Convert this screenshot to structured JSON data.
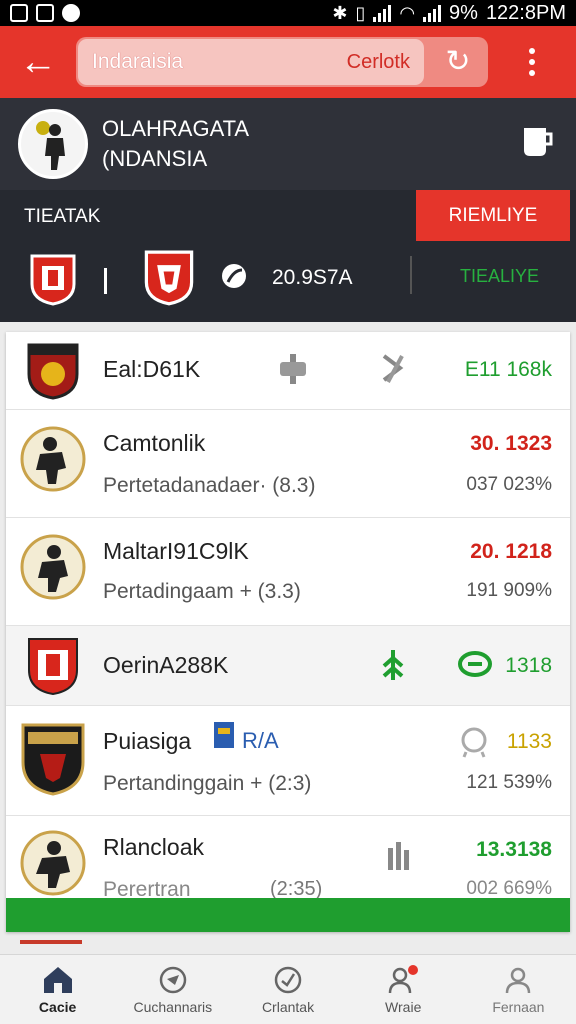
{
  "status_bar": {
    "battery": "9%",
    "time": "122:8PM"
  },
  "app_bar": {
    "search_value": "Indaraisia",
    "search_hint": "Cerlotk"
  },
  "profile": {
    "title_line1": "OLAHRAGATA",
    "title_line2": "(NDANSIA"
  },
  "match_strip": {
    "label": "TIEATAK",
    "live_button": "RIEMLIYE",
    "score": "20.9S7A",
    "live_text": "TIEALIYE"
  },
  "colors": {
    "accent": "#e5352b",
    "dark": "#2f3139",
    "green": "#1f9e2f",
    "gold": "#c9a200",
    "red": "#d1231b"
  },
  "list": [
    {
      "name": "Eal:D61K",
      "value_top": "E11  168k"
    },
    {
      "name": "Camtonlik",
      "sub": "Pertetadanadaer· (8.3)",
      "value_top": "30. 1323",
      "value_bottom": "037  023%"
    },
    {
      "name": "MaltarI91C9lK",
      "sub": "Pertadingaam   +   (3.3)",
      "value_top": "20. 1218",
      "value_bottom": "191  909%"
    },
    {
      "name": "OerinA288K",
      "value_top": "1318"
    },
    {
      "name": "Puiasiga",
      "tag": "R/A",
      "sub": "Pertandinggain  +   (2:3)",
      "value_top": "1133",
      "value_bottom": "121  539%"
    },
    {
      "name": "Rlancloak",
      "sub": "Perertran",
      "sub_right": "(2:35)",
      "value_top": "13.3138",
      "value_bottom": "002  669%"
    }
  ],
  "bottom_nav": [
    {
      "label": "Cacie",
      "icon": "home-icon"
    },
    {
      "label": "Cuchannaris",
      "icon": "compass-icon"
    },
    {
      "label": "Crlantak",
      "icon": "check-circle-icon"
    },
    {
      "label": "Wraie",
      "icon": "people-icon"
    },
    {
      "label": "Fernaan",
      "icon": "person-icon"
    }
  ]
}
